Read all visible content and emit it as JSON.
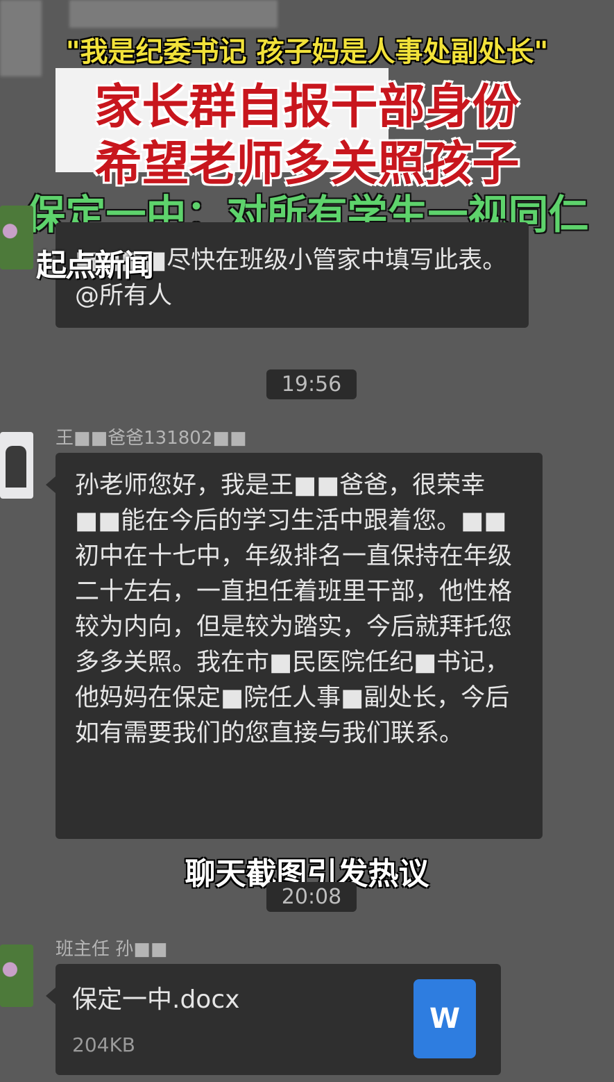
{
  "captions": {
    "line1": "\"我是纪委书记 孩子妈是人事处副处长\"",
    "line2": "家长群自报干部身份",
    "line3": "希望老师多关照孩子",
    "line4": "保定一中：对所有学生一视同仁",
    "sub": "聊天截图引发热议",
    "watermark": "起点新闻"
  },
  "message1": {
    "text": "■■■■尽快在班级小管家中填写此表。@所有人"
  },
  "time1": "19:56",
  "message2": {
    "sender": "王■■爸爸131802■■",
    "text": "孙老师您好，我是王■■爸爸，很荣幸■■能在今后的学习生活中跟着您。■■初中在十七中，年级排名一直保持在年级二十左右，一直担任着班里干部，他性格较为内向，但是较为踏实，今后就拜托您多多关照。我在市■民医院任纪■书记，他妈妈在保定■院任人事■副处长，今后如有需要我们的您直接与我们联系。"
  },
  "time2": "20:08",
  "message3": {
    "sender": "班主任 孙■■",
    "file_name": "保定一中.docx",
    "file_size": "204KB",
    "file_icon": "W"
  }
}
